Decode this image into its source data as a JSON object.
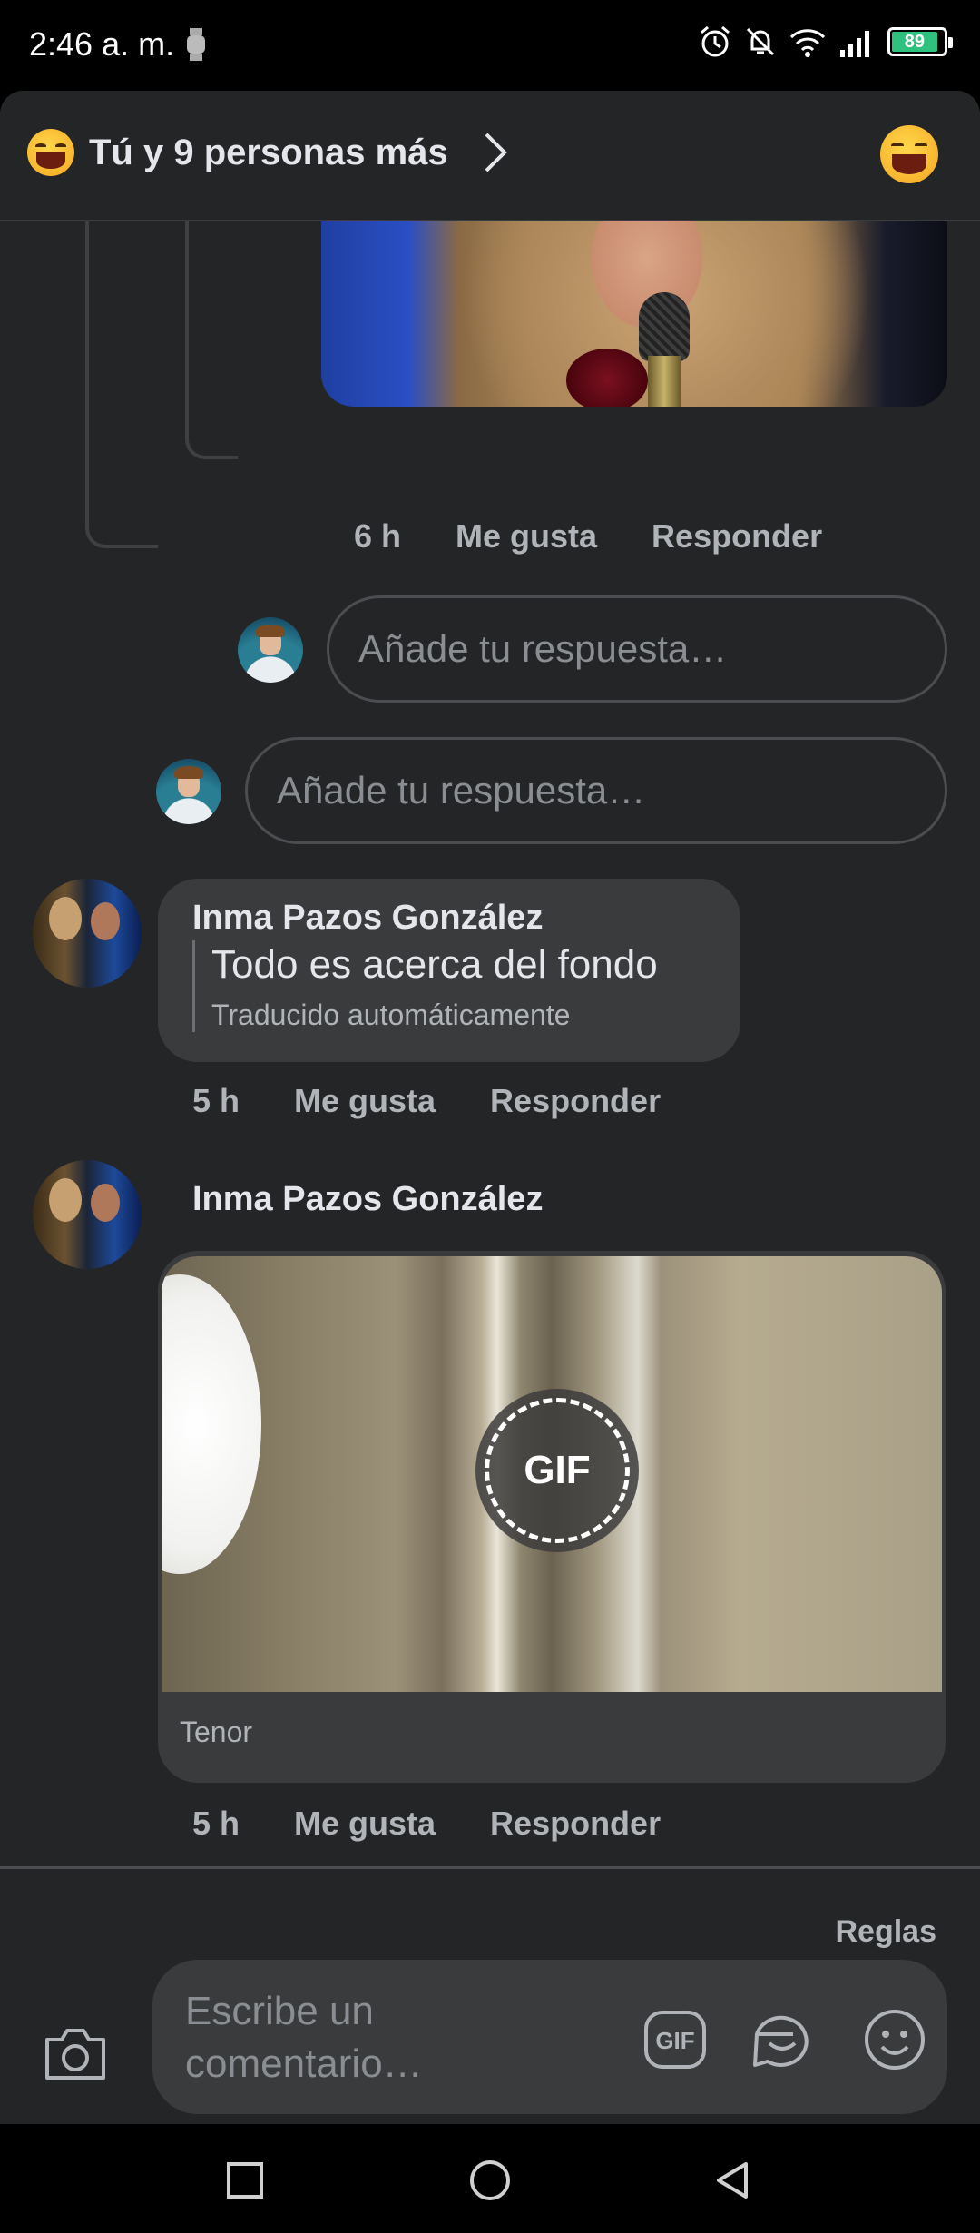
{
  "status_bar": {
    "time": "2:46 a. m.",
    "battery": "89"
  },
  "header": {
    "title": "Tú y 9 personas más"
  },
  "thread_top": {
    "meta": {
      "time": "6 h",
      "like": "Me gusta",
      "reply": "Responder"
    },
    "reply_placeholder_nested": "Añade tu respuesta…",
    "reply_placeholder": "Añade tu respuesta…"
  },
  "comments": [
    {
      "author": "Inma Pazos González",
      "text": "Todo es acerca del fondo",
      "translated_note": "Traducido automáticamente",
      "meta": {
        "time": "5 h",
        "like": "Me gusta",
        "reply": "Responder"
      }
    },
    {
      "author": "Inma Pazos González",
      "gif_label": "GIF",
      "gif_source": "Tenor",
      "meta": {
        "time": "5 h",
        "like": "Me gusta",
        "reply": "Responder"
      }
    }
  ],
  "composer": {
    "rules": "Reglas",
    "placeholder": "Escribe un comentario…",
    "gif_button": "GIF"
  },
  "icons": {
    "header_emoji": "laughing-emoji-icon",
    "camera": "camera-icon",
    "sticker": "sticker-icon",
    "emoji": "smiley-icon"
  }
}
